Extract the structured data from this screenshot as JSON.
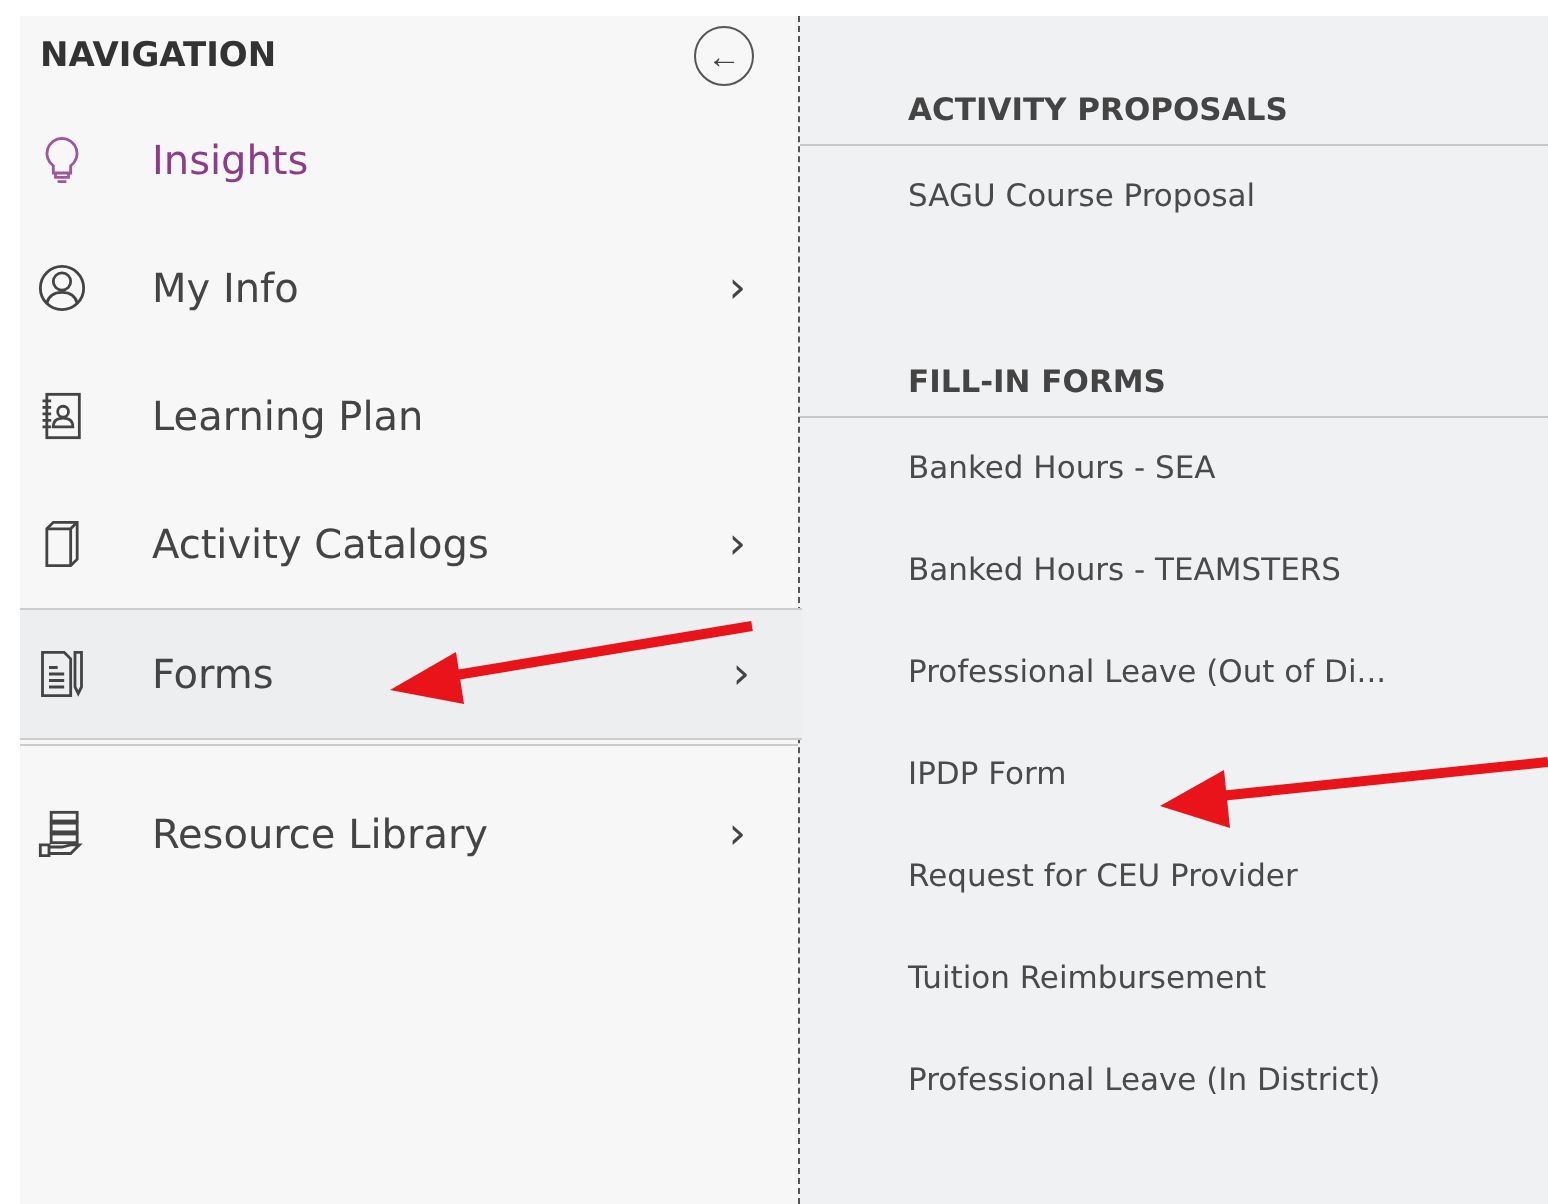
{
  "navigation": {
    "title": "NAVIGATION",
    "collapse_button": "←",
    "items": [
      {
        "label": "Insights",
        "kind": "bulb",
        "current": true,
        "selected": false
      },
      {
        "label": "My Info",
        "kind": "person",
        "current": false,
        "selected": false,
        "chevron": "›"
      },
      {
        "label": "Learning Plan",
        "kind": "notebook",
        "current": false,
        "selected": false
      },
      {
        "label": "Activity Catalogs",
        "kind": "book",
        "current": false,
        "selected": false,
        "chevron": "›"
      },
      {
        "label": "Forms",
        "kind": "form",
        "current": false,
        "selected": true,
        "chevron": "›"
      },
      {
        "label": "Resource Library",
        "kind": "library",
        "current": false,
        "selected": false,
        "chevron": "›"
      }
    ]
  },
  "submenu": {
    "sections": [
      {
        "heading": "ACTIVITY PROPOSALS",
        "items": [
          "SAGU Course Proposal"
        ]
      },
      {
        "heading": "FILL-IN FORMS",
        "items": [
          "Banked Hours - SEA",
          "Banked Hours - TEAMSTERS",
          "Professional Leave (Out of Di...",
          "IPDP Form",
          "Request for CEU Provider",
          "Tuition Reimbursement",
          "Professional Leave (In District)"
        ]
      }
    ]
  }
}
